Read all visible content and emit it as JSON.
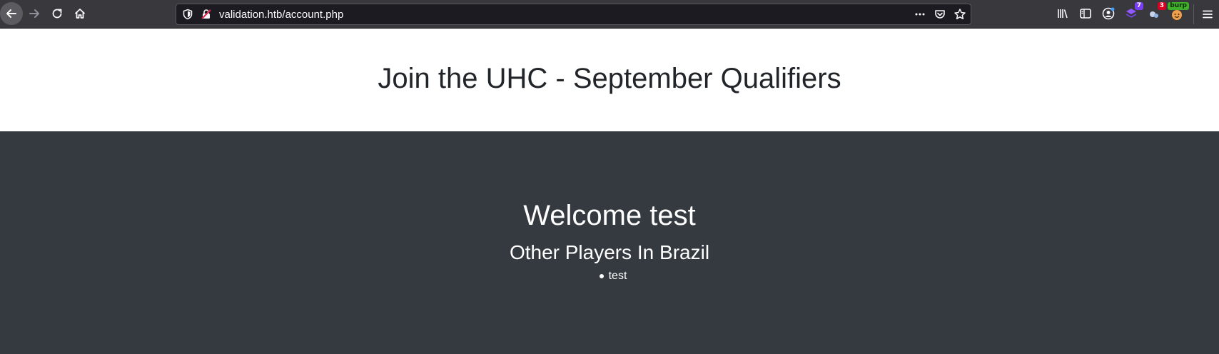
{
  "browser": {
    "url": "validation.htb/account.php",
    "icons": {
      "back": "arrow-left-icon",
      "forward": "arrow-right-icon",
      "reload": "reload-icon",
      "home": "home-icon",
      "shield": "shield-icon",
      "lock": "insecure-lock-icon",
      "more": "ellipsis-icon",
      "pocket": "pocket-icon",
      "bookmark": "star-icon",
      "library": "library-icon",
      "sidebar": "sidebar-icon",
      "account": "account-icon",
      "menu": "hamburger-menu-icon"
    },
    "extensions": [
      {
        "name": "extension-purple-icon",
        "badge": "7"
      },
      {
        "name": "extension-puzzle-icon",
        "badge": "3"
      },
      {
        "name": "burp-extension-icon",
        "badge": "burp"
      }
    ]
  },
  "header": {
    "title": "Join the UHC - September Qualifiers"
  },
  "main": {
    "welcome": "Welcome test",
    "subtitle": "Other Players In Brazil",
    "players": [
      "test"
    ]
  },
  "colors": {
    "toolbar_bg": "#38383d",
    "urlbar_bg": "#1c1b22",
    "header_bg": "#ffffff",
    "main_bg": "#343a40",
    "title_text": "#212529",
    "main_text": "#ffffff"
  }
}
